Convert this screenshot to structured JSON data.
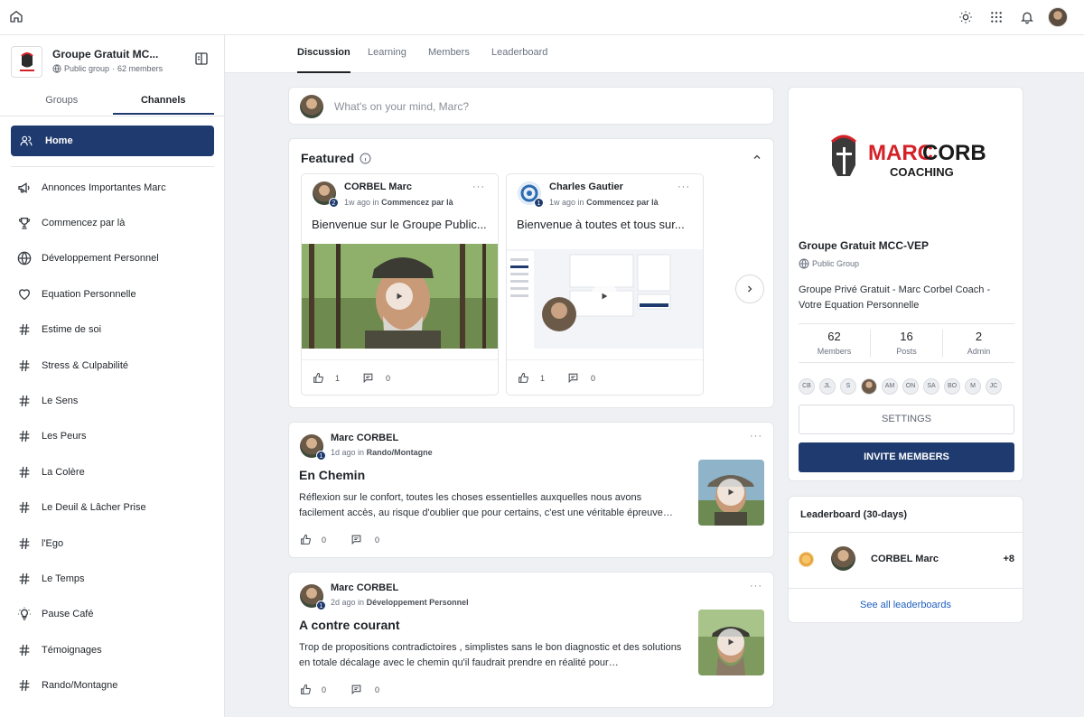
{
  "group": {
    "name": "Groupe Gratuit MC...",
    "visibility": "Public group",
    "members_count": "62 members"
  },
  "sidebar": {
    "tabs": [
      "Groups",
      "Channels"
    ],
    "active_tab": "Channels",
    "home_label": "Home",
    "channels": [
      {
        "label": "Annonces Importantes Marc",
        "icon": "megaphone-icon"
      },
      {
        "label": "Commencez par là",
        "icon": "trophy-icon"
      },
      {
        "label": "Développement Personnel",
        "icon": "globe-icon"
      },
      {
        "label": "Equation Personnelle",
        "icon": "heart-icon"
      },
      {
        "label": "Estime de soi",
        "icon": "hash-icon"
      },
      {
        "label": "Stress & Culpabilité",
        "icon": "hash-icon"
      },
      {
        "label": "Le Sens",
        "icon": "hash-icon"
      },
      {
        "label": "Les Peurs",
        "icon": "hash-icon"
      },
      {
        "label": "La Colère",
        "icon": "hash-icon"
      },
      {
        "label": "Le Deuil & Lâcher Prise",
        "icon": "hash-icon"
      },
      {
        "label": "l'Ego",
        "icon": "hash-icon"
      },
      {
        "label": "Le Temps",
        "icon": "hash-icon"
      },
      {
        "label": "Pause Café",
        "icon": "bulb-icon"
      },
      {
        "label": "Témoignages",
        "icon": "hash-icon"
      },
      {
        "label": "Rando/Montagne",
        "icon": "hash-icon"
      }
    ]
  },
  "main_tabs": [
    "Discussion",
    "Learning",
    "Members",
    "Leaderboard"
  ],
  "composer": {
    "placeholder": "What's on your mind, Marc?"
  },
  "featured": {
    "title": "Featured",
    "cards": [
      {
        "author": "CORBEL Marc",
        "badge": "2",
        "ago": "1w ago",
        "in_word": "in",
        "channel": "Commencez par là",
        "headline": "Bienvenue sur le Groupe Public...",
        "likes": "1",
        "comments": "0"
      },
      {
        "author": "Charles Gautier",
        "badge": "1",
        "ago": "1w ago",
        "in_word": "in",
        "channel": "Commencez par là",
        "headline": "Bienvenue à toutes et tous sur...",
        "likes": "1",
        "comments": "0"
      }
    ]
  },
  "posts": [
    {
      "author": "Marc CORBEL",
      "badge": "1",
      "ago": "1d ago",
      "in_word": "in",
      "channel": "Rando/Montagne",
      "title": "En Chemin",
      "excerpt": "Réflexion sur le confort, toutes les choses essentielles auxquelles nous avons facilement accès, au risque d'oublier que pour certains, c'est une véritable épreuve…",
      "likes": "0",
      "comments": "0"
    },
    {
      "author": "Marc CORBEL",
      "badge": "1",
      "ago": "2d ago",
      "in_word": "in",
      "channel": "Développement Personnel",
      "title": "A contre courant",
      "excerpt": "Trop de propositions contradictoires , simplistes sans le bon diagnostic et des solutions en totale décalage avec le chemin qu'il faudrait prendre en réalité pour…",
      "likes": "0",
      "comments": "0"
    }
  ],
  "about": {
    "logo_line1_a": "MARC",
    "logo_line1_b": "CORBEL",
    "logo_line2": "COACHING",
    "name": "Groupe Gratuit MCC-VEP",
    "type": "Public Group",
    "description": "Groupe Privé Gratuit - Marc Corbel Coach - Votre Equation Personnelle",
    "stats": [
      {
        "value": "62",
        "label": "Members"
      },
      {
        "value": "16",
        "label": "Posts"
      },
      {
        "value": "2",
        "label": "Admin"
      }
    ],
    "member_initials": [
      "CB",
      "JL",
      "S",
      "",
      "AM",
      "ON",
      "SA",
      "BO",
      "M",
      "JC"
    ],
    "settings_label": "SETTINGS",
    "invite_label": "INVITE MEMBERS"
  },
  "leaderboard": {
    "title": "Leaderboard (30-days)",
    "rows": [
      {
        "name": "CORBEL Marc",
        "points": "+8"
      }
    ],
    "see_all": "See all leaderboards"
  },
  "colors": {
    "primary": "#1e3a6e",
    "link": "#1f5fbf",
    "logo_red": "#d42027"
  }
}
